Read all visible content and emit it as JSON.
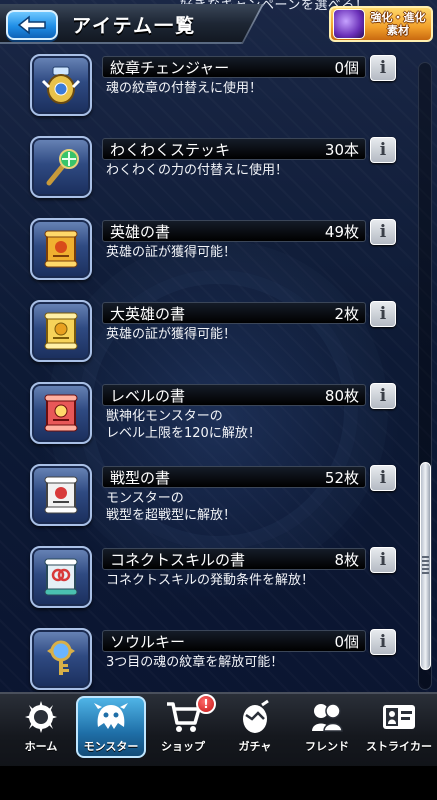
{
  "header": {
    "marquee_text": "好きなキャンペーンを選べる！",
    "title": "アイテム一覧",
    "evo_button_label": "強化・進化\n素材"
  },
  "items": [
    {
      "name": "紋章チェンジャー",
      "count": "0個",
      "desc": "魂の紋章の付替えに使用！",
      "icon": "crest-changer-icon"
    },
    {
      "name": "わくわくステッキ",
      "count": "30本",
      "desc": "わくわくの力の付替えに使用！",
      "icon": "waku-stick-icon"
    },
    {
      "name": "英雄の書",
      "count": "49枚",
      "desc": "英雄の証が獲得可能！",
      "icon": "hero-book-icon"
    },
    {
      "name": "大英雄の書",
      "count": "2枚",
      "desc": "英雄の証が獲得可能！",
      "icon": "great-hero-book-icon"
    },
    {
      "name": "レベルの書",
      "count": "80枚",
      "desc": "獣神化モンスターの\nレベル上限を120に解放！",
      "icon": "level-book-icon"
    },
    {
      "name": "戦型の書",
      "count": "52枚",
      "desc": "モンスターの\n戦型を超戦型に解放！",
      "icon": "battle-type-book-icon"
    },
    {
      "name": "コネクトスキルの書",
      "count": "8枚",
      "desc": "コネクトスキルの発動条件を解放！",
      "icon": "connect-skill-book-icon"
    },
    {
      "name": "ソウルキー",
      "count": "0個",
      "desc": "3つ目の魂の紋章を解放可能！",
      "icon": "soul-key-icon"
    }
  ],
  "info_label": "i",
  "nav": {
    "items": [
      {
        "label": "ホーム",
        "icon": "home-icon"
      },
      {
        "label": "モンスター",
        "icon": "monster-icon"
      },
      {
        "label": "ショップ",
        "icon": "cart-icon"
      },
      {
        "label": "ガチャ",
        "icon": "gacha-egg-icon"
      },
      {
        "label": "フレンド",
        "icon": "friends-icon"
      },
      {
        "label": "ストライカー",
        "icon": "striker-card-icon"
      }
    ],
    "active_index": 1,
    "shop_badge": "!"
  },
  "colors": {
    "active_tab": "#2f8ecf",
    "back_button": "#1f8ee6",
    "badge": "#c41616"
  }
}
